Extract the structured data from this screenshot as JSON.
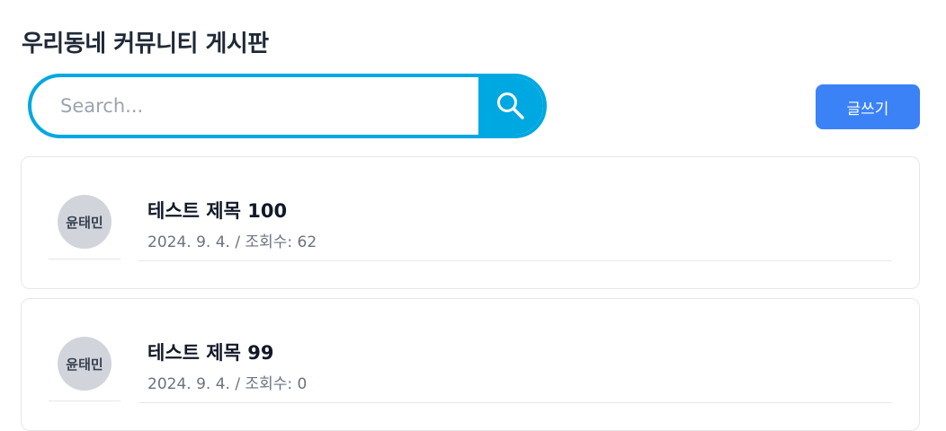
{
  "header": {
    "title": "우리동네 커뮤니티 게시판"
  },
  "search": {
    "placeholder": "Search...",
    "value": ""
  },
  "toolbar": {
    "write_label": "글쓰기"
  },
  "colors": {
    "search_accent": "#00a8e1",
    "write_button": "#3b82f6"
  },
  "posts": [
    {
      "author": "윤태민",
      "title": "테스트 제목 100",
      "date": "2024. 9. 4.",
      "views_label": "조회수",
      "views": "62",
      "meta": "2024. 9. 4. / 조회수: 62"
    },
    {
      "author": "윤태민",
      "title": "테스트 제목 99",
      "date": "2024. 9. 4.",
      "views_label": "조회수",
      "views": "0",
      "meta": "2024. 9. 4. / 조회수: 0"
    }
  ]
}
